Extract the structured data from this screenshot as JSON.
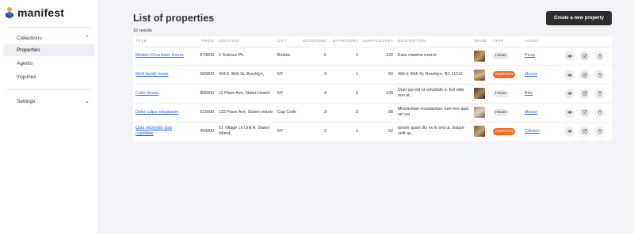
{
  "brand": {
    "name": "manifest"
  },
  "sidebar": {
    "collections": {
      "label": "Collections",
      "items": [
        {
          "label": "Properties",
          "active": true
        },
        {
          "label": "Agents",
          "active": false
        },
        {
          "label": "Inquiries",
          "active": false
        }
      ]
    },
    "settings": {
      "label": "Settings"
    }
  },
  "main": {
    "title": "List of properties",
    "result_count": "10 results",
    "create_button": "Create a new property"
  },
  "table": {
    "headers": {
      "title": "TITLE",
      "price": "PRICE",
      "location": "LOCATION",
      "city": "CITY",
      "bedrooms": "BEDROOMS",
      "bathrooms": "BATHROOMS",
      "surfacearea": "SURFACEAREA",
      "description": "DESCRIPTION",
      "image": "IMAGE",
      "type": "TYPE",
      "agent": "AGENT"
    },
    "rows": [
      {
        "title": "Modern Downtown House",
        "price": "870000",
        "location": "1 Science Pk.",
        "city": "Boston",
        "bedrooms": "6",
        "bathrooms": "2",
        "surfacearea": "120",
        "description": "Esse maxime exercit",
        "type": "House",
        "agent": "Pizza"
      },
      {
        "title": "Multi-family home",
        "price": "500000",
        "location": "494 E 96th St, Brooklyn,",
        "city": "NY",
        "bedrooms": "3",
        "bathrooms": "1",
        "surfacearea": "50",
        "description": "494 E 96th St, Brooklyn, NY 11212",
        "type": "Apartment",
        "agent": "Mouse"
      },
      {
        "title": "Calm House",
        "price": "865000",
        "location": "11 Piave Ave, Staten Island",
        "city": "NY",
        "bedrooms": "4",
        "bathrooms": "2",
        "surfacearea": "100",
        "description": "Duet qui est ut voluptate a. Est odio non at...",
        "type": "House",
        "agent": "Bike"
      },
      {
        "title": "Dolor culpa voluptatem",
        "price": "615000",
        "location": "133 Piave Ave, Staten Island",
        "city": "Cap Code",
        "bedrooms": "3",
        "bathrooms": "2",
        "surfacearea": "88",
        "description": "Minolestiae recusandae, iure eos quia vel sol...",
        "type": "House",
        "agent": "Mouse"
      },
      {
        "title": "Quia reiciendis ipsa cupiditate",
        "price": "456000",
        "location": "51 Village Ln Unit A, Staten Island,",
        "city": "NY",
        "bedrooms": "2",
        "bathrooms": "1",
        "surfacearea": "62",
        "description": "Ipsam quam illo ex in sed ut. Eaque velit qu...",
        "type": "Apartment",
        "agent": "Chicken"
      }
    ]
  },
  "icons": {
    "view": "eye-icon",
    "edit": "edit-icon",
    "delete": "trash-icon"
  },
  "colors": {
    "link": "#2563eb",
    "apartment_badge": "#f36b2a",
    "primary_button": "#2d2d2d"
  }
}
